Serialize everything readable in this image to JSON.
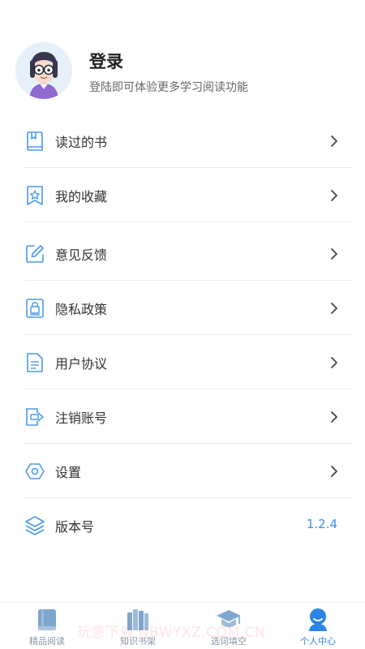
{
  "profile": {
    "title": "登录",
    "subtitle": "登陆即可体验更多学习阅读功能"
  },
  "menu": [
    {
      "label": "读过的书",
      "icon": "book-icon"
    },
    {
      "label": "我的收藏",
      "icon": "star-icon"
    },
    {
      "label": "意见反馈",
      "icon": "edit-icon"
    },
    {
      "label": "隐私政策",
      "icon": "lock-icon"
    },
    {
      "label": "用户协议",
      "icon": "document-icon"
    },
    {
      "label": "注销账号",
      "icon": "logout-icon"
    },
    {
      "label": "设置",
      "icon": "settings-icon"
    },
    {
      "label": "版本号",
      "icon": "layers-icon",
      "value": "1.2.4"
    }
  ],
  "tabbar": [
    {
      "label": "精品阅读",
      "icon": "book-icon",
      "active": false
    },
    {
      "label": "知识书架",
      "icon": "bookshelf-icon",
      "active": false
    },
    {
      "label": "选词填空",
      "icon": "graduation-cap-icon",
      "active": false
    },
    {
      "label": "个人中心",
      "icon": "person-icon",
      "active": true
    }
  ],
  "watermark": "玩意下载 NBWYXZ.COM.CN",
  "colors": {
    "accent": "#3d8de6",
    "icon_stroke": "#4a9be8",
    "tab_inactive": "#8a97a6",
    "divider": "#ececec"
  }
}
